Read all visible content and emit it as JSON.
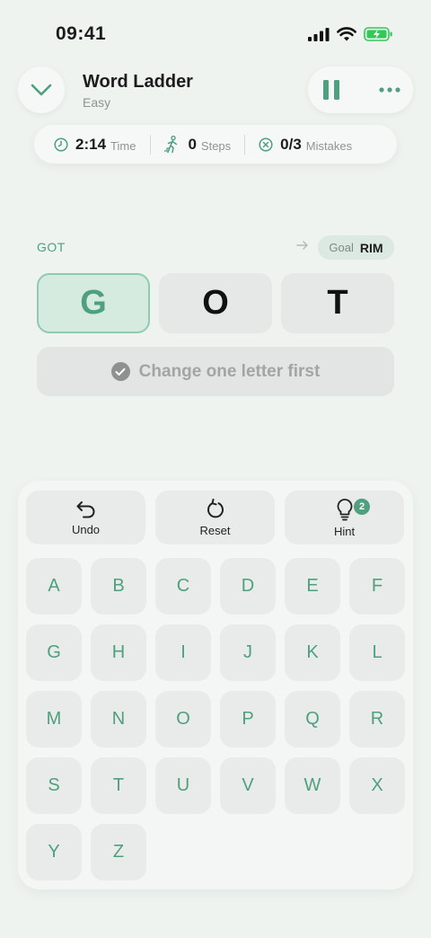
{
  "status_bar": {
    "time": "09:41"
  },
  "header": {
    "title": "Word Ladder",
    "subtitle": "Easy"
  },
  "stats": {
    "time_value": "2:14",
    "time_label": "Time",
    "steps_value": "0",
    "steps_label": "Steps",
    "mistakes_value": "0/3",
    "mistakes_label": "Mistakes"
  },
  "puzzle": {
    "start_word": "GOT",
    "goal_label": "Goal",
    "goal_word": "RIM",
    "tiles": [
      "G",
      "O",
      "T"
    ],
    "active_tile": 0,
    "hint_text": "Change one letter first"
  },
  "actions": {
    "undo_label": "Undo",
    "reset_label": "Reset",
    "hint_label": "Hint",
    "hint_count": "2"
  },
  "keys": [
    "A",
    "B",
    "C",
    "D",
    "E",
    "F",
    "G",
    "H",
    "I",
    "J",
    "K",
    "L",
    "M",
    "N",
    "O",
    "P",
    "Q",
    "R",
    "S",
    "T",
    "U",
    "V",
    "W",
    "X",
    "Y",
    "Z"
  ],
  "colors": {
    "accent": "#4ea07e",
    "background": "#eef3f0",
    "battery": "#34c759"
  }
}
